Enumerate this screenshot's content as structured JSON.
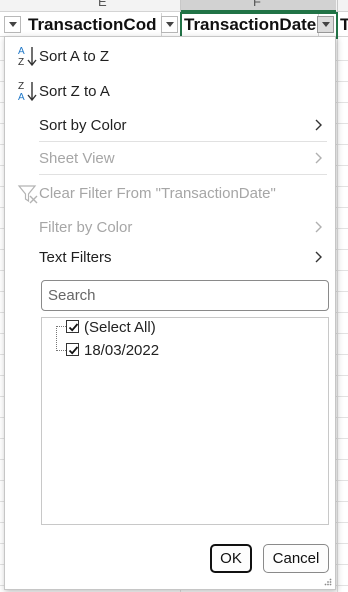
{
  "columns": {
    "letters": [
      "E",
      "F"
    ],
    "headers": [
      "TransactionCod",
      "TransactionDate",
      "T"
    ]
  },
  "menu": {
    "sort_az": "Sort A to Z",
    "sort_za": "Sort Z to A",
    "sort_by_color": "Sort by Color",
    "sheet_view": "Sheet View",
    "clear_filter": "Clear Filter From \"TransactionDate\"",
    "filter_by_color": "Filter by Color",
    "text_filters": "Text Filters"
  },
  "search": {
    "placeholder": "Search",
    "value": ""
  },
  "list": {
    "items": [
      {
        "label": "(Select All)",
        "checked": true
      },
      {
        "label": "18/03/2022",
        "checked": true
      }
    ]
  },
  "buttons": {
    "ok": "OK",
    "cancel": "Cancel"
  },
  "colors": {
    "accent_green": "#217346",
    "sort_blue": "#1e77c7",
    "disabled_gray": "#a6a6a6"
  },
  "icons": [
    "sort-az-icon",
    "sort-za-icon",
    "clear-filter-icon",
    "chevron-right-icon",
    "dropdown-arrow-icon",
    "checkmark-icon",
    "resize-grip-icon"
  ]
}
